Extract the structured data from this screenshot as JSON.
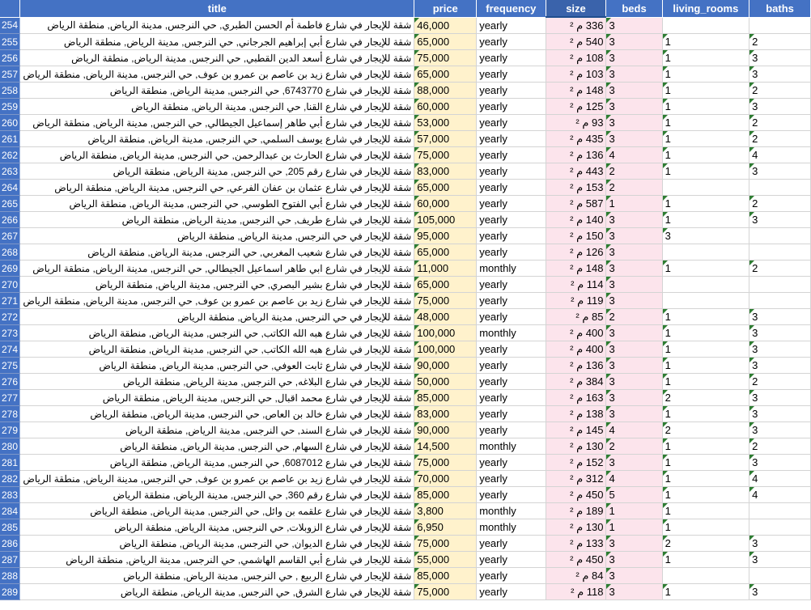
{
  "headers": {
    "title": "title",
    "price": "price",
    "frequency": "frequency",
    "size": "size",
    "beds": "beds",
    "living_rooms": "living_rooms",
    "baths": "baths"
  },
  "rows": [
    {
      "n": "254",
      "title": "شقة للإيجار في شارع فاطمة أم الحسن الطبري, حي النرجس, مدينة الرياض, منطقة الرياض",
      "price": "46,000",
      "freq": "yearly",
      "size": "336 م ²",
      "beds": "3",
      "living": "",
      "baths": ""
    },
    {
      "n": "255",
      "title": "شقة للإيجار في شارع أبي إبراهيم الجرجاني, حي النرجس, مدينة الرياض, منطقة الرياض",
      "price": "65,000",
      "freq": "yearly",
      "size": "540 م ²",
      "beds": "3",
      "living": "1",
      "baths": "2"
    },
    {
      "n": "256",
      "title": "شقة للإيجار في شارع أسعد الدين القطبي, حي النرجس, مدينة الرياض, منطقة الرياض",
      "price": "75,000",
      "freq": "yearly",
      "size": "108 م ²",
      "beds": "3",
      "living": "1",
      "baths": "3"
    },
    {
      "n": "257",
      "title": "شقة للإيجار في شارع زيد بن عاصم بن عمرو بن عوف, حي النرجس, مدينة الرياض, منطقة الرياض",
      "price": "65,000",
      "freq": "yearly",
      "size": "103 م ²",
      "beds": "3",
      "living": "1",
      "baths": "3"
    },
    {
      "n": "258",
      "title": "شقة للإيجار في شارع 6743770, حي النرجس, مدينة الرياض, منطقة الرياض",
      "price": "88,000",
      "freq": "yearly",
      "size": "148 م ²",
      "beds": "3",
      "living": "1",
      "baths": "2"
    },
    {
      "n": "259",
      "title": "شقة للإيجار في شارع القنا, حي النرجس, مدينة الرياض, منطقة الرياض",
      "price": "60,000",
      "freq": "yearly",
      "size": "125 م ²",
      "beds": "3",
      "living": "1",
      "baths": "3"
    },
    {
      "n": "260",
      "title": "شقة للإيجار في شارع أبي طاهر إسماعيل الجيطالي, حي النرجس, مدينة الرياض, منطقة الرياض",
      "price": "53,000",
      "freq": "yearly",
      "size": "93 م ²",
      "beds": "3",
      "living": "1",
      "baths": "2"
    },
    {
      "n": "261",
      "title": "شقة للإيجار في شارع يوسف السلمي, حي النرجس, مدينة الرياض, منطقة الرياض",
      "price": "57,000",
      "freq": "yearly",
      "size": "435 م ²",
      "beds": "3",
      "living": "1",
      "baths": "2"
    },
    {
      "n": "262",
      "title": "شقة للإيجار في شارع الحارث بن عبدالرحمن, حي النرجس, مدينة الرياض, منطقة الرياض",
      "price": "75,000",
      "freq": "yearly",
      "size": "136 م ²",
      "beds": "4",
      "living": "1",
      "baths": "4"
    },
    {
      "n": "263",
      "title": "شقة للإيجار في شارع رقم 205, حي النرجس, مدينة الرياض, منطقة الرياض",
      "price": "83,000",
      "freq": "yearly",
      "size": "443 م ²",
      "beds": "2",
      "living": "1",
      "baths": "3"
    },
    {
      "n": "264",
      "title": "شقة للإيجار في شارع عثمان بن عفان الفرعي, حي النرجس, مدينة الرياض, منطقة الرياض",
      "price": "65,000",
      "freq": "yearly",
      "size": "153 م ²",
      "beds": "2",
      "living": "",
      "baths": ""
    },
    {
      "n": "265",
      "title": "شقة للإيجار في شارع أبي الفتوح الطوسي, حي النرجس, مدينة الرياض, منطقة الرياض",
      "price": "60,000",
      "freq": "yearly",
      "size": "587 م ²",
      "beds": "1",
      "living": "1",
      "baths": "2"
    },
    {
      "n": "266",
      "title": "شقة للإيجار في شارع طريف, حي النرجس, مدينة الرياض, منطقة الرياض",
      "price": "105,000",
      "freq": "yearly",
      "size": "140 م ²",
      "beds": "3",
      "living": "1",
      "baths": "3"
    },
    {
      "n": "267",
      "title": "شقة للإيجار في حي النرجس, مدينة الرياض, منطقة الرياض",
      "price": "95,000",
      "freq": "yearly",
      "size": "150 م ²",
      "beds": "3",
      "living": "3",
      "baths": ""
    },
    {
      "n": "268",
      "title": "شقة للإيجار في شارع شعيب المغربي, حي النرجس, مدينة الرياض, منطقة الرياض",
      "price": "65,000",
      "freq": "yearly",
      "size": "126 م ²",
      "beds": "3",
      "living": "",
      "baths": ""
    },
    {
      "n": "269",
      "title": "شقة للإيجار في شارع ابي طاهر اسماعيل الجيطالي, حي النرجس, مدينة الرياض, منطقة الرياض",
      "price": "11,000",
      "freq": "monthly",
      "size": "148 م ²",
      "beds": "3",
      "living": "1",
      "baths": "2"
    },
    {
      "n": "270",
      "title": "شقة للإيجار في شارع بشير البصري, حي النرجس, مدينة الرياض, منطقة الرياض",
      "price": "65,000",
      "freq": "yearly",
      "size": "114 م ²",
      "beds": "3",
      "living": "",
      "baths": ""
    },
    {
      "n": "271",
      "title": "شقة للإيجار في شارع زيد بن عاصم بن عمرو بن عوف, حي النرجس, مدينة الرياض, منطقة الرياض",
      "price": "75,000",
      "freq": "yearly",
      "size": "119 م ²",
      "beds": "3",
      "living": "",
      "baths": ""
    },
    {
      "n": "272",
      "title": "شقة للإيجار في حي النرجس, مدينة الرياض, منطقة الرياض",
      "price": "48,000",
      "freq": "yearly",
      "size": "85 م ²",
      "beds": "2",
      "living": "1",
      "baths": "3"
    },
    {
      "n": "273",
      "title": "شقة للإيجار في شارع هبه الله الكاتب, حي النرجس, مدينة الرياض, منطقة الرياض",
      "price": "100,000",
      "freq": "monthly",
      "size": "400 م ²",
      "beds": "3",
      "living": "1",
      "baths": "3"
    },
    {
      "n": "274",
      "title": "شقة للإيجار في شارع هبه الله الكاتب, حي النرجس, مدينة الرياض, منطقة الرياض",
      "price": "100,000",
      "freq": "yearly",
      "size": "400 م ²",
      "beds": "3",
      "living": "1",
      "baths": "3"
    },
    {
      "n": "275",
      "title": "شقة للإيجار في شارع ثابت العوفي, حي النرجس, مدينة الرياض, منطقة الرياض",
      "price": "90,000",
      "freq": "yearly",
      "size": "136 م ²",
      "beds": "3",
      "living": "1",
      "baths": "3"
    },
    {
      "n": "276",
      "title": "شقة للإيجار في شارع البلاغه, حي النرجس, مدينة الرياض, منطقة الرياض",
      "price": "50,000",
      "freq": "yearly",
      "size": "384 م ²",
      "beds": "3",
      "living": "1",
      "baths": "2"
    },
    {
      "n": "277",
      "title": "شقة للإيجار في شارع محمد اقبال, حي النرجس, مدينة الرياض, منطقة الرياض",
      "price": "85,000",
      "freq": "yearly",
      "size": "163 م ²",
      "beds": "3",
      "living": "2",
      "baths": "3"
    },
    {
      "n": "278",
      "title": "شقة للإيجار في شارع خالد بن العاص, حي النرجس, مدينة الرياض, منطقة الرياض",
      "price": "83,000",
      "freq": "yearly",
      "size": "138 م ²",
      "beds": "3",
      "living": "1",
      "baths": "3"
    },
    {
      "n": "279",
      "title": "شقة للإيجار في شارع السند, حي النرجس, مدينة الرياض, منطقة الرياض",
      "price": "90,000",
      "freq": "yearly",
      "size": "145 م ²",
      "beds": "4",
      "living": "2",
      "baths": "3"
    },
    {
      "n": "280",
      "title": "شقة للإيجار في شارع السهام, حي النرجس, مدينة الرياض, منطقة الرياض",
      "price": "14,500",
      "freq": "monthly",
      "size": "130 م ²",
      "beds": "2",
      "living": "1",
      "baths": "2"
    },
    {
      "n": "281",
      "title": "شقة للإيجار في شارع 6087012, حي النرجس, مدينة الرياض, منطقة الرياض",
      "price": "75,000",
      "freq": "yearly",
      "size": "152 م ²",
      "beds": "3",
      "living": "1",
      "baths": "3"
    },
    {
      "n": "282",
      "title": "شقة للإيجار في شارع زيد بن عاصم بن عمرو بن عوف, حي النرجس, مدينة الرياض, منطقة الرياض",
      "price": "70,000",
      "freq": "yearly",
      "size": "312 م ²",
      "beds": "4",
      "living": "1",
      "baths": "4"
    },
    {
      "n": "283",
      "title": "شقة للإيجار في شارع رقم 360, حي النرجس, مدينة الرياض, منطقة الرياض",
      "price": "85,000",
      "freq": "yearly",
      "size": "450 م ²",
      "beds": "5",
      "living": "1",
      "baths": "4"
    },
    {
      "n": "284",
      "title": "شقة للإيجار في شارع علقمه بن وائل, حي النرجس, مدينة الرياض, منطقة الرياض",
      "price": "3,800",
      "freq": "monthly",
      "size": "189 م ²",
      "beds": "1",
      "living": "1",
      "baths": ""
    },
    {
      "n": "285",
      "title": "شقة للإيجار في شارع الزوبلات, حي النرجس, مدينة الرياض, منطقة الرياض",
      "price": "6,950",
      "freq": "monthly",
      "size": "130 م ²",
      "beds": "1",
      "living": "1",
      "baths": ""
    },
    {
      "n": "286",
      "title": "شقة للإيجار في شارع الديوان, حي النرجس, مدينة الرياض, منطقة الرياض",
      "price": "75,000",
      "freq": "yearly",
      "size": "133 م ²",
      "beds": "3",
      "living": "2",
      "baths": "3"
    },
    {
      "n": "287",
      "title": "شقة للإيجار في شارع أبي القاسم الهاشمي, حي النرجس, مدينة الرياض, منطقة الرياض",
      "price": "55,000",
      "freq": "yearly",
      "size": "450 م ²",
      "beds": "3",
      "living": "1",
      "baths": "3"
    },
    {
      "n": "288",
      "title": "شقة للإيجار في شارع الربيع , حي النرجس, مدينة الرياض, منطقة الرياض",
      "price": "85,000",
      "freq": "yearly",
      "size": "84 م ²",
      "beds": "3",
      "living": "",
      "baths": ""
    },
    {
      "n": "289",
      "title": "شقة للإيجار في شارع الشرق, حي النرجس, مدينة الرياض, منطقة الرياض",
      "price": "75,000",
      "freq": "yearly",
      "size": "118 م ²",
      "beds": "3",
      "living": "1",
      "baths": "3"
    }
  ]
}
